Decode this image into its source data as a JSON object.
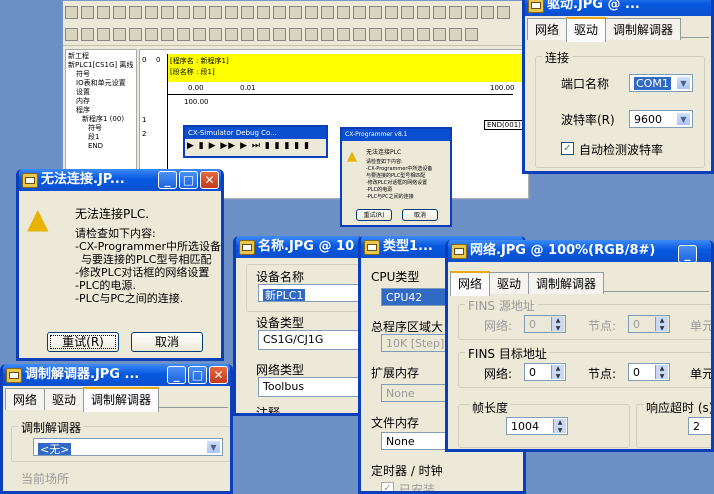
{
  "main": {
    "tree": [
      "新工程",
      "新PLC1[CS1G] 离线",
      "符号",
      "IO表和单元设置",
      "设置",
      "内存",
      "程序",
      "新程序1 (00)",
      "符号",
      "段1",
      "END"
    ],
    "ladder": {
      "row_header": "0",
      "row_line": "0",
      "program_name": "[程序名 : 新程序1]",
      "section_name": "[段名称 : 段1]",
      "contact1": "0.00",
      "contact2": "0.01",
      "coil": "100.00",
      "coil_out": "100.00",
      "row2": "1",
      "row3": "2",
      "end_label": "END(001)"
    }
  },
  "debug_console": {
    "title": "CX-Simulator Debug Co..."
  },
  "small_dialog": {
    "title": "CX-Programmer v8.1",
    "text": "无法连接PLC",
    "details": [
      "请检查如下内容:",
      "-CX-Programmer中所选设备",
      "与要连接的PLC型号相匹配",
      "-修改PLC对话框的网络设置",
      "-PLC的电源",
      "-PLC与PC之间的连接"
    ],
    "retry": "重试(R)",
    "cancel": "取消"
  },
  "conn_error": {
    "title": "无法连接.JP...",
    "message": "无法连接PLC.",
    "lines": [
      "请检查如下内容:",
      "-CX-Programmer中所选设备",
      "与要连接的PLC型号相匹配",
      "-修改PLC对话框的网络设置",
      "-PLC的电源.",
      "-PLC与PC之间的连接."
    ],
    "retry": "重试(R)",
    "cancel": "取消"
  },
  "driver_win": {
    "title": "驱动.JPG @ ...",
    "tabs": [
      "网络",
      "驱动",
      "调制解调器"
    ],
    "group": "连接",
    "port_label": "端口名称",
    "port_value": "COM1",
    "baud_label": "波特率(R)",
    "baud_value": "9600",
    "auto_label": "自动检测波特率"
  },
  "name_win": {
    "title": "名称.JPG @ 10",
    "device_name_label": "设备名称",
    "device_name_value": "新PLC1",
    "device_type_label": "设备类型",
    "device_type_value": "CS1G/CJ1G",
    "network_type_label": "网络类型",
    "network_type_value": "Toolbus",
    "note_label": "注释"
  },
  "type_win": {
    "title": "类型1...",
    "cpu_label": "CPU类型",
    "cpu_value": "CPU42",
    "program_area_label": "总程序区域大",
    "program_area_value": "10K [Step]",
    "ext_mem_label": "扩展内存",
    "ext_mem_value": "None",
    "file_mem_label": "文件内存",
    "file_mem_value": "None",
    "timer_label": "定时器 / 时钟",
    "installed_label": "已安装"
  },
  "modem_win": {
    "title": "调制解调器.JPG ...",
    "tabs": [
      "网络",
      "驱动",
      "调制解调器"
    ],
    "group": "调制解调器",
    "modem_value": "<无>",
    "current_location": "当前场所"
  },
  "network_win": {
    "title": "网络.JPG @ 100%(RGB/8#)",
    "tabs": [
      "网络",
      "驱动",
      "调制解调器"
    ],
    "fins_src": "FINS 源地址",
    "fins_dst": "FINS 目标地址",
    "network_label": "网络:",
    "node_label": "节点:",
    "unit_label": "单元",
    "src_network": "0",
    "src_node": "0",
    "dst_network": "0",
    "dst_node": "0",
    "frame_label": "帧长度",
    "frame_value": "1004",
    "timeout_label": "响应超时 (s)",
    "timeout_value": "2"
  }
}
